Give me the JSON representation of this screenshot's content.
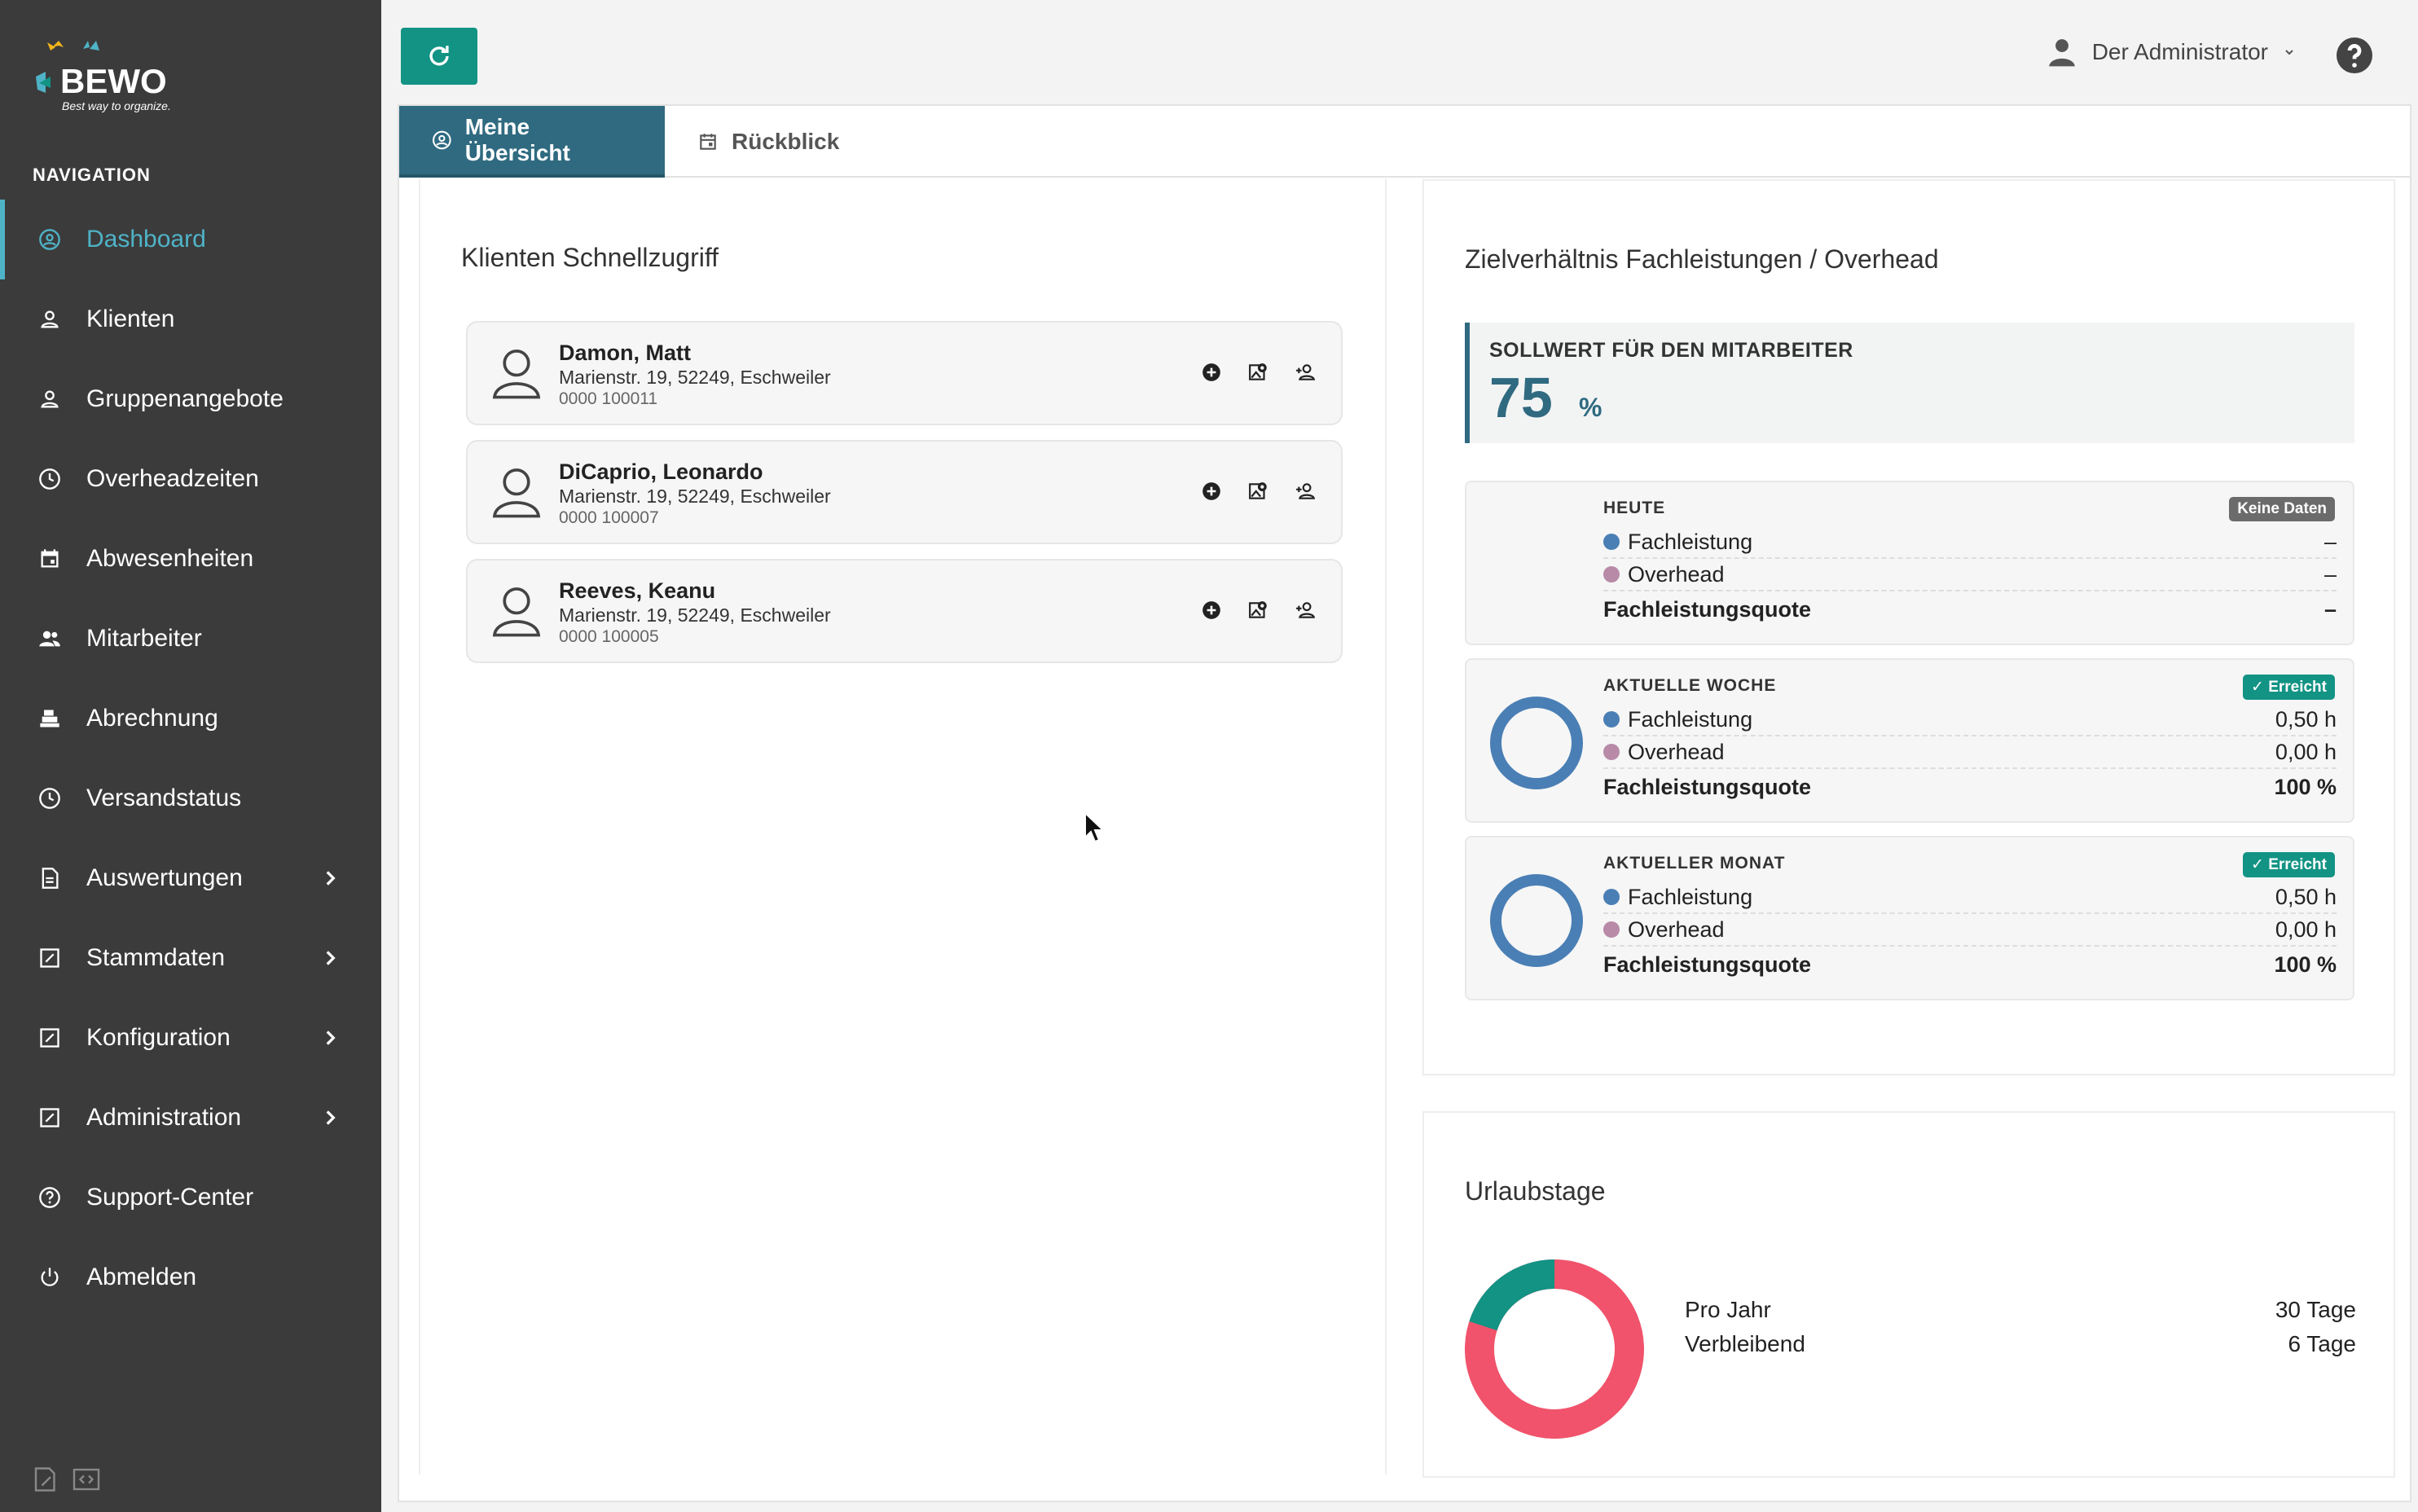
{
  "brand": {
    "name": "BEWO",
    "tagline": "Best way to organize."
  },
  "nav": {
    "heading": "NAVIGATION",
    "items": [
      {
        "label": "Dashboard",
        "icon": "dashboard-icon",
        "active": true
      },
      {
        "label": "Klienten",
        "icon": "person-icon"
      },
      {
        "label": "Gruppenangebote",
        "icon": "person-icon"
      },
      {
        "label": "Overheadzeiten",
        "icon": "clock-icon"
      },
      {
        "label": "Abwesenheiten",
        "icon": "calendar-icon"
      },
      {
        "label": "Mitarbeiter",
        "icon": "group-icon"
      },
      {
        "label": "Abrechnung",
        "icon": "cash-register-icon"
      },
      {
        "label": "Versandstatus",
        "icon": "clock-icon"
      },
      {
        "label": "Auswertungen",
        "icon": "document-icon",
        "submenu": true
      },
      {
        "label": "Stammdaten",
        "icon": "edit-icon",
        "submenu": true
      },
      {
        "label": "Konfiguration",
        "icon": "edit-icon",
        "submenu": true
      },
      {
        "label": "Administration",
        "icon": "edit-icon",
        "submenu": true
      },
      {
        "label": "Support-Center",
        "icon": "help-circle-icon"
      },
      {
        "label": "Abmelden",
        "icon": "power-icon"
      }
    ]
  },
  "header": {
    "user": "Der Administrator"
  },
  "tabs": [
    {
      "label": "Meine Übersicht",
      "active": true
    },
    {
      "label": "Rückblick",
      "active": false
    }
  ],
  "clients": {
    "title": "Klienten Schnellzugriff",
    "items": [
      {
        "name": "Damon, Matt",
        "address": "Marienstr. 19, 52249, Eschweiler",
        "number": "0000 100011"
      },
      {
        "name": "DiCaprio, Leonardo",
        "address": "Marienstr. 19, 52249, Eschweiler",
        "number": "0000 100007"
      },
      {
        "name": "Reeves, Keanu",
        "address": "Marienstr. 19, 52249, Eschweiler",
        "number": "0000 100005"
      }
    ]
  },
  "ratio": {
    "title": "Zielverhältnis Fachleistungen / Overhead",
    "target_label": "SOLLWERT FÜR DEN MITARBEITER",
    "target_value": "75",
    "target_unit": "%",
    "colors": {
      "fachleistung": "#4a7fb5",
      "overhead": "#b88aa8",
      "accent": "#2f6a80"
    },
    "periods": [
      {
        "label": "HEUTE",
        "badge": "Keine Daten",
        "badge_type": "grey",
        "fach_label": "Fachleistung",
        "fach": "–",
        "over_label": "Overhead",
        "over": "–",
        "quote_label": "Fachleistungsquote",
        "quote": "–",
        "fach_share": null
      },
      {
        "label": "AKTUELLE WOCHE",
        "badge": "Erreicht",
        "badge_type": "green",
        "fach_label": "Fachleistung",
        "fach": "0,50 h",
        "over_label": "Overhead",
        "over": "0,00 h",
        "quote_label": "Fachleistungsquote",
        "quote": "100 %",
        "fach_share": 1.0
      },
      {
        "label": "AKTUELLER MONAT",
        "badge": "Erreicht",
        "badge_type": "green",
        "fach_label": "Fachleistung",
        "fach": "0,50 h",
        "over_label": "Overhead",
        "over": "0,00 h",
        "quote_label": "Fachleistungsquote",
        "quote": "100 %",
        "fach_share": 1.0
      }
    ]
  },
  "vacation": {
    "title": "Urlaubstage",
    "per_year_label": "Pro Jahr",
    "per_year": "30 Tage",
    "remaining_label": "Verbleibend",
    "remaining": "6 Tage",
    "per_year_value": 30,
    "remaining_value": 6,
    "colors": {
      "used": "#f0536b",
      "remaining": "#129384"
    }
  }
}
